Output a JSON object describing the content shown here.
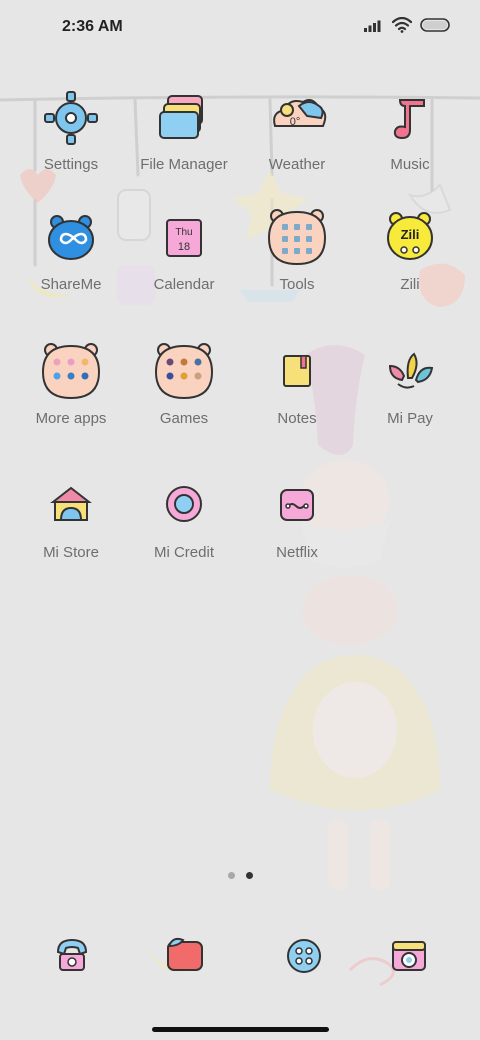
{
  "status_bar": {
    "time": "2:36 AM",
    "icons": [
      "signal-icon",
      "wifi-icon",
      "battery-icon"
    ]
  },
  "home": {
    "apps": [
      {
        "label": "Settings",
        "icon": "settings-icon"
      },
      {
        "label": "File Manager",
        "icon": "file-manager-icon"
      },
      {
        "label": "Weather",
        "icon": "weather-icon",
        "icon_text": "0°"
      },
      {
        "label": "Music",
        "icon": "music-icon"
      },
      {
        "label": "ShareMe",
        "icon": "shareme-icon"
      },
      {
        "label": "Calendar",
        "icon": "calendar-icon",
        "icon_day": "Thu",
        "icon_date": "18"
      },
      {
        "label": "Tools",
        "icon": "folder-icon"
      },
      {
        "label": "Zili",
        "icon": "zili-icon",
        "icon_text": "Zili"
      },
      {
        "label": "More apps",
        "icon": "folder-icon"
      },
      {
        "label": "Games",
        "icon": "folder-icon"
      },
      {
        "label": "Notes",
        "icon": "notes-icon"
      },
      {
        "label": "Mi Pay",
        "icon": "mi-pay-icon"
      },
      {
        "label": "Mi Store",
        "icon": "mi-store-icon"
      },
      {
        "label": "Mi Credit",
        "icon": "mi-credit-icon"
      },
      {
        "label": "Netflix",
        "icon": "netflix-icon"
      }
    ],
    "page_indicator": {
      "pages": 2,
      "current": 2
    }
  },
  "dock": {
    "items": [
      {
        "icon": "phone-icon"
      },
      {
        "icon": "messages-icon"
      },
      {
        "icon": "browser-icon"
      },
      {
        "icon": "camera-icon"
      }
    ]
  },
  "colors": {
    "background": "#e6e6e6",
    "label": "#6e6e6e",
    "folder": "#f9d3c0",
    "blue": "#4aa3e8",
    "pink": "#f08aa8",
    "yellow": "#f7e87a"
  }
}
